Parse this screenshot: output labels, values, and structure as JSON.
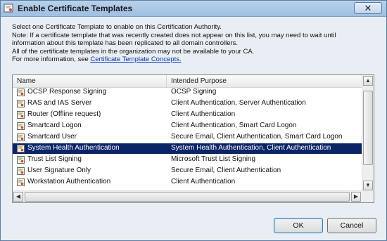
{
  "window": {
    "title": "Enable Certificate Templates",
    "close_glyph": "✕"
  },
  "info": {
    "lines": [
      "Select one Certificate Template to enable on this Certification Authority.",
      "Note: If a certificate template that was recently created does not appear on this list, you may need to wait until",
      "information about this template has been replicated to all domain controllers.",
      "All of the certificate templates in the organization may not be available to your CA."
    ],
    "more_prefix": "For more information, see ",
    "more_link": "Certificate Template Concepts."
  },
  "list": {
    "columns": [
      "Name",
      "Intended Purpose"
    ],
    "rows": [
      {
        "name": "OCSP Response Signing",
        "purpose": "OCSP Signing",
        "selected": false
      },
      {
        "name": "RAS and IAS Server",
        "purpose": "Client Authentication, Server Authentication",
        "selected": false
      },
      {
        "name": "Router (Offline request)",
        "purpose": "Client Authentication",
        "selected": false
      },
      {
        "name": "Smartcard Logon",
        "purpose": "Client Authentication, Smart Card Logon",
        "selected": false
      },
      {
        "name": "Smartcard User",
        "purpose": "Secure Email, Client Authentication, Smart Card Logon",
        "selected": false
      },
      {
        "name": "System Health Authentication",
        "purpose": "System Health Authentication, Client Authentication",
        "selected": true
      },
      {
        "name": "Trust List Signing",
        "purpose": "Microsoft Trust List Signing",
        "selected": false
      },
      {
        "name": "User Signature Only",
        "purpose": "Secure Email, Client Authentication",
        "selected": false
      },
      {
        "name": "Workstation Authentication",
        "purpose": "Client Authentication",
        "selected": false
      }
    ]
  },
  "buttons": {
    "ok": "OK",
    "cancel": "Cancel"
  },
  "icons": {
    "row_icon": "certificate-template-icon",
    "title_icon": "certificate-icon"
  },
  "colors": {
    "selection": "#0b2467",
    "title_bar": "#b9d1ea"
  }
}
